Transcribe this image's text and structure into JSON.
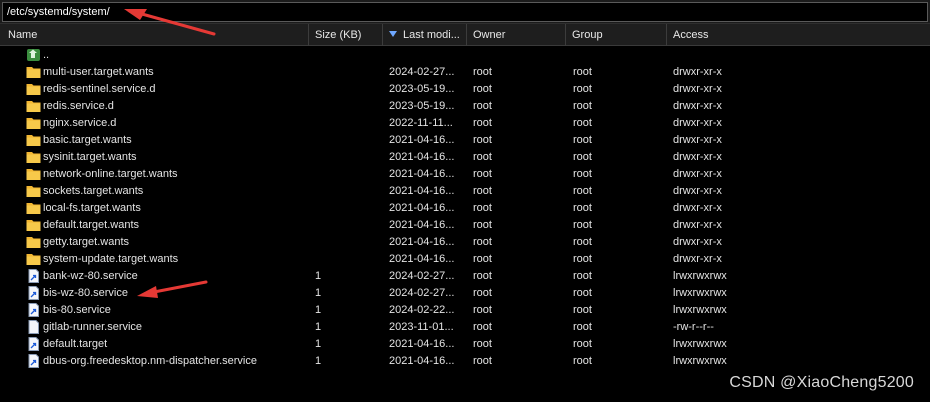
{
  "path_bar": {
    "value": "/etc/systemd/system/"
  },
  "columns": {
    "name": "Name",
    "size": "Size (KB)",
    "modified": "Last modi...",
    "owner": "Owner",
    "group": "Group",
    "access": "Access"
  },
  "rows": [
    {
      "type": "up",
      "name": "..",
      "size": "",
      "modified": "",
      "owner": "",
      "group": "",
      "access": ""
    },
    {
      "type": "folder",
      "name": "multi-user.target.wants",
      "size": "",
      "modified": "2024-02-27...",
      "owner": "root",
      "group": "root",
      "access": "drwxr-xr-x"
    },
    {
      "type": "folder",
      "name": "redis-sentinel.service.d",
      "size": "",
      "modified": "2023-05-19...",
      "owner": "root",
      "group": "root",
      "access": "drwxr-xr-x"
    },
    {
      "type": "folder",
      "name": "redis.service.d",
      "size": "",
      "modified": "2023-05-19...",
      "owner": "root",
      "group": "root",
      "access": "drwxr-xr-x"
    },
    {
      "type": "folder",
      "name": "nginx.service.d",
      "size": "",
      "modified": "2022-11-11...",
      "owner": "root",
      "group": "root",
      "access": "drwxr-xr-x"
    },
    {
      "type": "folder",
      "name": "basic.target.wants",
      "size": "",
      "modified": "2021-04-16...",
      "owner": "root",
      "group": "root",
      "access": "drwxr-xr-x"
    },
    {
      "type": "folder",
      "name": "sysinit.target.wants",
      "size": "",
      "modified": "2021-04-16...",
      "owner": "root",
      "group": "root",
      "access": "drwxr-xr-x"
    },
    {
      "type": "folder",
      "name": "network-online.target.wants",
      "size": "",
      "modified": "2021-04-16...",
      "owner": "root",
      "group": "root",
      "access": "drwxr-xr-x"
    },
    {
      "type": "folder",
      "name": "sockets.target.wants",
      "size": "",
      "modified": "2021-04-16...",
      "owner": "root",
      "group": "root",
      "access": "drwxr-xr-x"
    },
    {
      "type": "folder",
      "name": "local-fs.target.wants",
      "size": "",
      "modified": "2021-04-16...",
      "owner": "root",
      "group": "root",
      "access": "drwxr-xr-x"
    },
    {
      "type": "folder",
      "name": "default.target.wants",
      "size": "",
      "modified": "2021-04-16...",
      "owner": "root",
      "group": "root",
      "access": "drwxr-xr-x"
    },
    {
      "type": "folder",
      "name": "getty.target.wants",
      "size": "",
      "modified": "2021-04-16...",
      "owner": "root",
      "group": "root",
      "access": "drwxr-xr-x"
    },
    {
      "type": "folder",
      "name": "system-update.target.wants",
      "size": "",
      "modified": "2021-04-16...",
      "owner": "root",
      "group": "root",
      "access": "drwxr-xr-x"
    },
    {
      "type": "link",
      "name": "bank-wz-80.service",
      "size": "1",
      "modified": "2024-02-27...",
      "owner": "root",
      "group": "root",
      "access": "lrwxrwxrwx"
    },
    {
      "type": "link",
      "name": "bis-wz-80.service",
      "size": "1",
      "modified": "2024-02-27...",
      "owner": "root",
      "group": "root",
      "access": "lrwxrwxrwx"
    },
    {
      "type": "link",
      "name": "bis-80.service",
      "size": "1",
      "modified": "2024-02-22...",
      "owner": "root",
      "group": "root",
      "access": "lrwxrwxrwx"
    },
    {
      "type": "file",
      "name": "gitlab-runner.service",
      "size": "1",
      "modified": "2023-11-01...",
      "owner": "root",
      "group": "root",
      "access": "-rw-r--r--"
    },
    {
      "type": "link",
      "name": "default.target",
      "size": "1",
      "modified": "2021-04-16...",
      "owner": "root",
      "group": "root",
      "access": "lrwxrwxrwx"
    },
    {
      "type": "link",
      "name": "dbus-org.freedesktop.nm-dispatcher.service",
      "size": "1",
      "modified": "2021-04-16...",
      "owner": "root",
      "group": "root",
      "access": "lrwxrwxrwx"
    }
  ],
  "watermark": "CSDN @XiaoCheng5200",
  "colors": {
    "annotation_arrow": "#e53935",
    "folder": "#f2b632",
    "up_icon": "#4caf50",
    "sort_arrow": "#6fa8ff"
  }
}
